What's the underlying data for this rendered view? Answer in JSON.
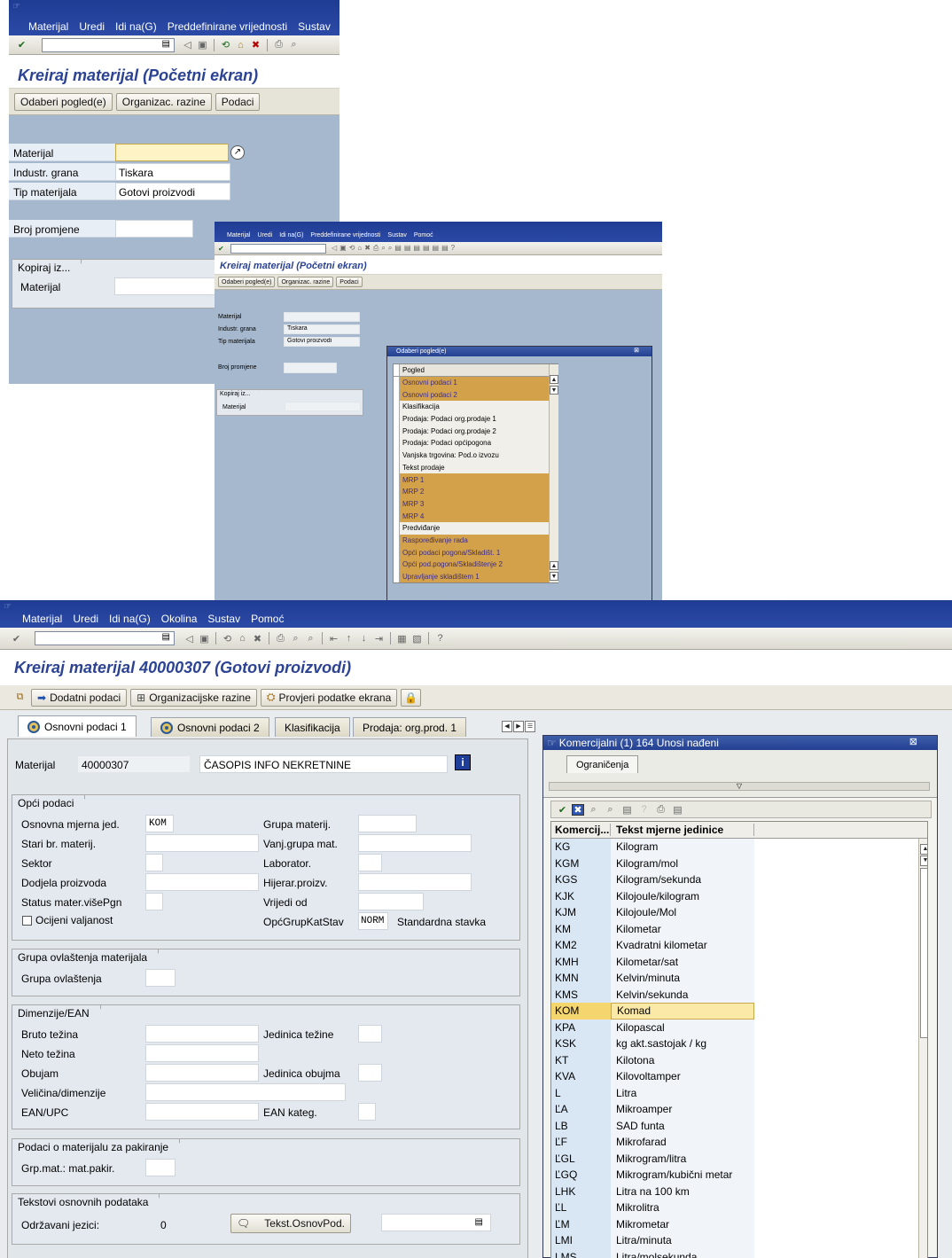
{
  "win1": {
    "menu": [
      "Materijal",
      "Uredi",
      "Idi na(G)",
      "Preddefinirane vrijednosti",
      "Sustav"
    ],
    "title": "Kreiraj materijal (Početni ekran)",
    "buttons": [
      "Odaberi pogled(e)",
      "Organizac. razine",
      "Podaci"
    ],
    "fields": {
      "materijal_label": "Materijal",
      "materijal_value": "",
      "industr_label": "Industr. grana",
      "industr_value": "Tiskara",
      "tip_label": "Tip materijala",
      "tip_value": "Gotovi proizvodi",
      "broj_label": "Broj promjene"
    },
    "kopiraj_title": "Kopiraj iz...",
    "kopiraj_label": "Materijal"
  },
  "win2": {
    "menu": [
      "Materijal",
      "Uredi",
      "Idi na(G)",
      "Preddefinirane vrijednosti",
      "Sustav",
      "Pomoć"
    ],
    "title": "Kreiraj materijal (Početni ekran)",
    "buttons": [
      "Odaberi pogled(e)",
      "Organizac. razine",
      "Podaci"
    ],
    "fields": {
      "materijal_label": "Materijal",
      "industr_label": "Industr. grana",
      "industr_value": "Tiskara",
      "tip_label": "Tip materijala",
      "tip_value": "Gotovi proizvodi",
      "broj_label": "Broj promjene"
    },
    "kopiraj_title": "Kopiraj iz...",
    "kopiraj_label": "Materijal",
    "popup_title": "Odaberi pogled(e)",
    "list_header": "Pogled",
    "views": [
      {
        "t": "Osnovni podaci 1",
        "sel": true
      },
      {
        "t": "Osnovni podaci 2",
        "sel": true
      },
      {
        "t": "Klasifikacija",
        "sel": false
      },
      {
        "t": "Prodaja: Podaci org.prodaje 1",
        "sel": false
      },
      {
        "t": "Prodaja: Podaci org.prodaje 2",
        "sel": false
      },
      {
        "t": "Prodaja: Podaci općipogona",
        "sel": false
      },
      {
        "t": "Vanjska trgovina: Pod.o izvozu",
        "sel": false
      },
      {
        "t": "Tekst prodaje",
        "sel": false
      },
      {
        "t": "MRP 1",
        "sel": true
      },
      {
        "t": "MRP 2",
        "sel": true
      },
      {
        "t": "MRP 3",
        "sel": true
      },
      {
        "t": "MRP 4",
        "sel": true
      },
      {
        "t": "Predviđanje",
        "sel": false
      },
      {
        "t": "Raspoređivanje rada",
        "sel": true
      },
      {
        "t": "Opći podaci pogona/Skladišt. 1",
        "sel": true
      },
      {
        "t": "Opći pod.pogona/Skladištenje 2",
        "sel": true
      },
      {
        "t": "Upravljanje skladištem 1",
        "sel": true
      }
    ]
  },
  "win3": {
    "menu": [
      "Materijal",
      "Uredi",
      "Idi na(G)",
      "Okolina",
      "Sustav",
      "Pomoć"
    ],
    "title": "Kreiraj materijal 40000307 (Gotovi proizvodi)",
    "appbar": {
      "dodatni": "Dodatni podaci",
      "org": "Organizacijske razine",
      "provjeri": "Provjeri podatke ekrana"
    },
    "tabs": [
      "Osnovni podaci 1",
      "Osnovni podaci 2",
      "Klasifikacija",
      "Prodaja: org.prod. 1"
    ],
    "material": {
      "label": "Materijal",
      "number": "40000307",
      "desc": "ČASOPIS INFO NEKRETNINE"
    },
    "opci": {
      "title": "Opći podaci",
      "osnovna_label": "Osnovna mjerna jed.",
      "osnovna_value": "KOM",
      "stari_label": "Stari br. materij.",
      "sektor_label": "Sektor",
      "dodjela_label": "Dodjela proizvoda",
      "status_label": "Status mater.višePgn",
      "ocijeni_label": "Ocijeni valjanost",
      "grupa_label": "Grupa materij.",
      "vanj_label": "Vanj.grupa mat.",
      "laborator_label": "Laborator.",
      "hijerar_label": "Hijerar.proizv.",
      "vrijedi_label": "Vrijedi od",
      "opcgrup_label": "OpćGrupKatStav",
      "opcgrup_value": "NORM",
      "opcgrup_text": "Standardna stavka"
    },
    "ovlastenja": {
      "title": "Grupa ovlaštenja materijala",
      "label": "Grupa ovlaštenja"
    },
    "dimenzije": {
      "title": "Dimenzije/EAN",
      "bruto": "Bruto težina",
      "neto": "Neto težina",
      "obujam": "Obujam",
      "velicina": "Veličina/dimenzije",
      "ean": "EAN/UPC",
      "jed_tezine": "Jedinica težine",
      "jed_obujma": "Jedinica obujma",
      "ean_kateg": "EAN kateg."
    },
    "pakiranje": {
      "title": "Podaci o materijalu za pakiranje",
      "label": "Grp.mat.: mat.pakir."
    },
    "tekstovi": {
      "title": "Tekstovi osnovnih podataka",
      "label": "Održavani jezici:",
      "value": "0",
      "button": "Tekst.OsnovPod."
    }
  },
  "popup3": {
    "title": "Komercijalni (1)  164 Unosi nađeni",
    "tab": "Ograničenja",
    "col1": "Komercij...",
    "col2": "Tekst mjerne jedinice",
    "rows": [
      [
        "KG",
        "Kilogram"
      ],
      [
        "KGM",
        "Kilogram/mol"
      ],
      [
        "KGS",
        "Kilogram/sekunda"
      ],
      [
        "KJK",
        "Kilojoule/kilogram"
      ],
      [
        "KJM",
        "Kilojoule/Mol"
      ],
      [
        "KM",
        "Kilometar"
      ],
      [
        "KM2",
        "Kvadratni kilometar"
      ],
      [
        "KMH",
        "Kilometar/sat"
      ],
      [
        "KMN",
        "Kelvin/minuta"
      ],
      [
        "KMS",
        "Kelvin/sekunda"
      ],
      [
        "KOM",
        "Komad"
      ],
      [
        "KPA",
        "Kilopascal"
      ],
      [
        "KSK",
        "kg akt.sastojak / kg"
      ],
      [
        "KT",
        "Kilotona"
      ],
      [
        "KVA",
        "Kilovoltamper"
      ],
      [
        "L",
        "Litra"
      ],
      [
        "ĽA",
        "Mikroamper"
      ],
      [
        "LB",
        "SAD funta"
      ],
      [
        "ĽF",
        "Mikrofarad"
      ],
      [
        "ĽGL",
        "Mikrogram/litra"
      ],
      [
        "ĽGQ",
        "Mikrogram/kubični metar"
      ],
      [
        "LHK",
        "Litra na 100 km"
      ],
      [
        "ĽL",
        "Mikrolitra"
      ],
      [
        "ĽM",
        "Mikrometar"
      ],
      [
        "LMI",
        "Litra/minuta"
      ],
      [
        "LMS",
        "Litra/molsekunda"
      ]
    ],
    "highlight": "KOM"
  },
  "colors": {
    "menubar": "#233f97",
    "title": "#2c4393",
    "background": "#a6b8cd",
    "selection": "#d2a14a",
    "highlight": "#f5d56d"
  }
}
